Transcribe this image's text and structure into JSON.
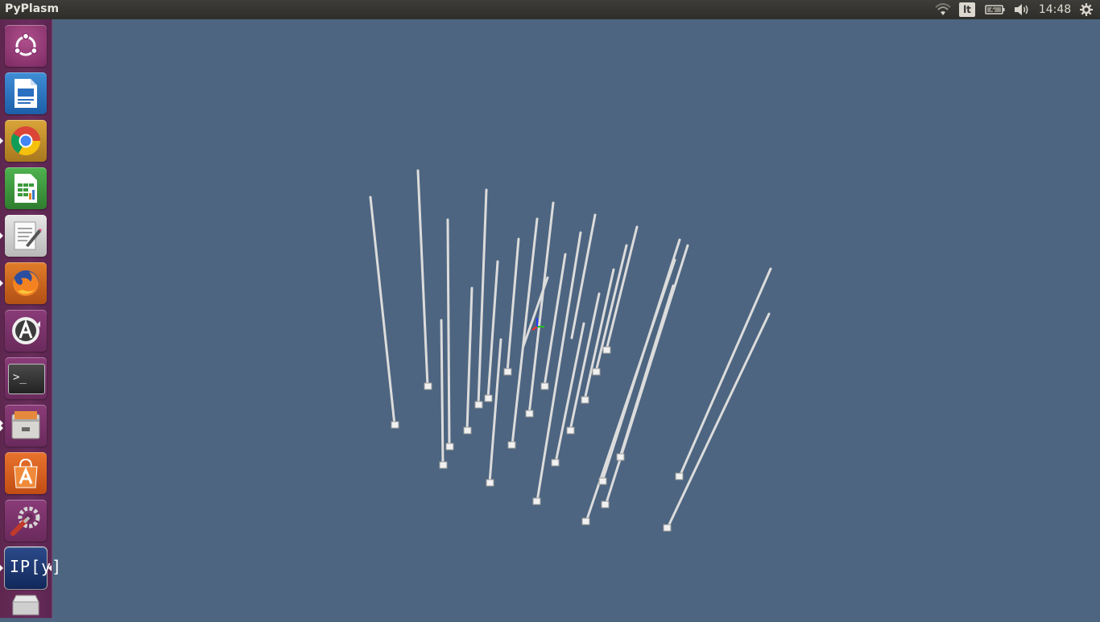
{
  "window": {
    "title": "PyPlasm"
  },
  "tray": {
    "wifi_icon": "wifi-icon",
    "keyboard_layout": "lt",
    "battery_icon": "battery-icon",
    "volume_icon": "volume-icon",
    "clock": "14:48",
    "settings_icon": "gear-icon"
  },
  "launcher": {
    "items": [
      {
        "name": "ubuntu-dash",
        "icon": "ubuntu-logo-icon"
      },
      {
        "name": "libreoffice-writer",
        "icon": "writer-icon"
      },
      {
        "name": "google-chrome",
        "icon": "chrome-icon"
      },
      {
        "name": "libreoffice-calc",
        "icon": "calc-icon"
      },
      {
        "name": "text-editor",
        "icon": "text-editor-icon"
      },
      {
        "name": "firefox",
        "icon": "firefox-icon"
      },
      {
        "name": "software-updater",
        "icon": "software-updater-icon"
      },
      {
        "name": "terminal",
        "icon": "terminal-icon"
      },
      {
        "name": "files",
        "icon": "files-icon"
      },
      {
        "name": "ubuntu-software",
        "icon": "software-center-icon"
      },
      {
        "name": "system-settings",
        "icon": "settings-wrench-icon"
      },
      {
        "name": "ipython",
        "icon": "ipython-icon",
        "label": "IP[y]"
      },
      {
        "name": "disk",
        "icon": "disk-icon"
      }
    ]
  },
  "viewer": {
    "background": "#4d6580",
    "object": "3D wireframe columns",
    "axis_colors": [
      "#ff2a2a",
      "#22c022",
      "#2a3cff"
    ]
  }
}
